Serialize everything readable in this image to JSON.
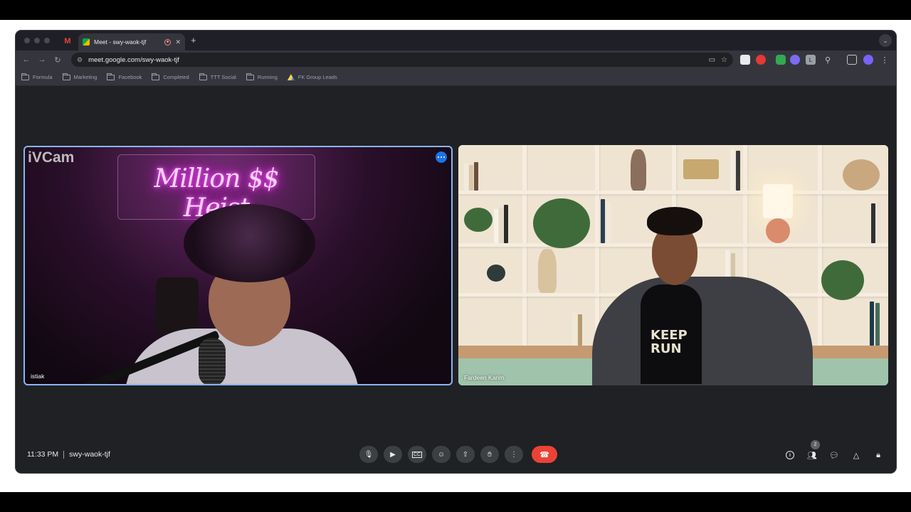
{
  "browser": {
    "active_tab_title": "Meet - swy-waok-tjf",
    "url": "meet.google.com/swy-waok-tjf",
    "new_tab_label": "+",
    "bookmarks": [
      {
        "label": "Formula",
        "icon": "folder-icon"
      },
      {
        "label": "Marketing",
        "icon": "folder-icon"
      },
      {
        "label": "Facebook",
        "icon": "folder-icon"
      },
      {
        "label": "Completed",
        "icon": "folder-icon"
      },
      {
        "label": "TTT Social",
        "icon": "folder-icon"
      },
      {
        "label": "Running",
        "icon": "folder-icon"
      },
      {
        "label": "FK Group Leads",
        "icon": "drive-icon"
      }
    ]
  },
  "meeting": {
    "time": "11:33 PM",
    "code": "swy-waok-tjf",
    "participant_count": "2"
  },
  "tiles": {
    "left": {
      "name": "istiak",
      "watermark": "iVCam",
      "neon_sign": "Million $$ Heist"
    },
    "right": {
      "name": "Fardeen Karim",
      "shirt_print": "KEEP\nRUN"
    }
  },
  "controls": {
    "mic": "microphone-icon",
    "camera": "camera-icon",
    "captions": "captions-icon",
    "emoji": "emoji-icon",
    "present": "present-icon",
    "raise_hand": "hand-icon",
    "more": "more-options-icon",
    "leave": "end-call-icon"
  },
  "colors": {
    "accent": "#8ab4f8",
    "end_call": "#ea4335",
    "background": "#202124"
  }
}
